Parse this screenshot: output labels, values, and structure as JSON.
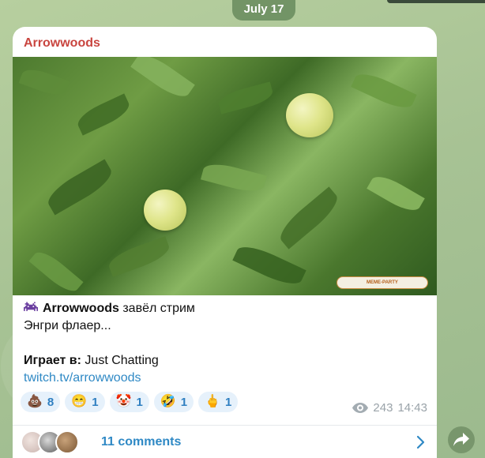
{
  "date_label": "July 17",
  "post": {
    "channel_name": "Arrowwoods",
    "author": "Arrowwoods",
    "action_text": " завёл стрим",
    "subtitle": "Энгри флаер...",
    "playing_label": "Играет в:",
    "playing_value": " Just Chatting",
    "link_text": "twitch.tv/arrowwoods",
    "watermark_text": "MEME-PARTY"
  },
  "reactions": [
    {
      "emoji": "💩",
      "count": "8"
    },
    {
      "emoji": "😁",
      "count": "1"
    },
    {
      "emoji": "🤡",
      "count": "1"
    },
    {
      "emoji": "🤣",
      "count": "1"
    },
    {
      "emoji": "🖕",
      "count": "1"
    }
  ],
  "meta": {
    "views": "243",
    "time": "14:43"
  },
  "comments": {
    "label": "11 comments"
  },
  "colors": {
    "channel_name": "#c9453f",
    "link": "#2f89c5",
    "reaction_bg": "#e6f1fb"
  }
}
